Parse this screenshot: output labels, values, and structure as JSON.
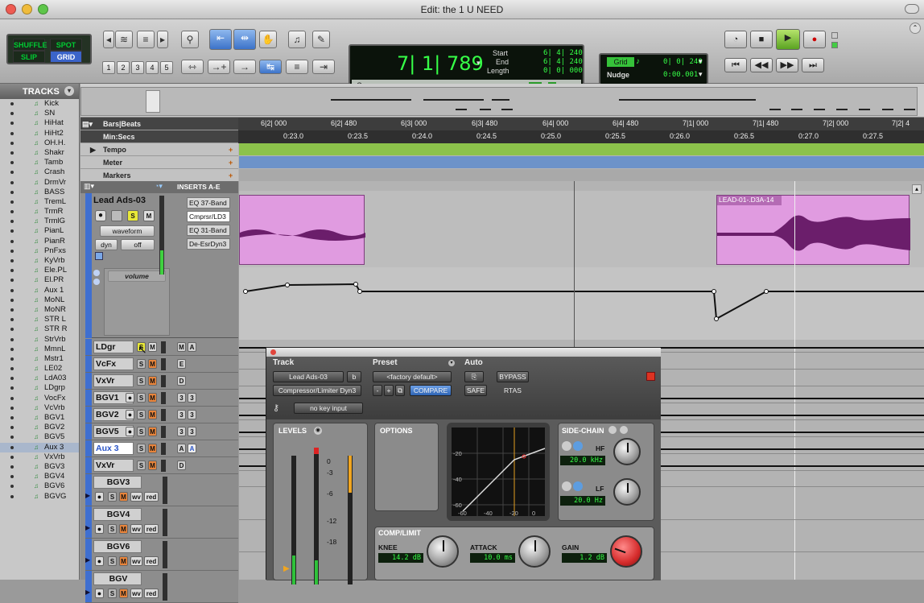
{
  "window": {
    "title": "Edit: the 1 U NEED"
  },
  "toolbar": {
    "modes": {
      "shuffle": "SHUFFLE",
      "spot": "SPOT",
      "slip": "SLIP",
      "grid": "GRID"
    },
    "zoom_presets": [
      "1",
      "2",
      "3",
      "4",
      "5"
    ],
    "counter": {
      "main": "7| 1| 789",
      "start_label": "Start",
      "end_label": "End",
      "length_label": "Length",
      "start": "6| 4| 240",
      "end": "6| 4| 240",
      "length": "0| 0| 000",
      "cursor_label": "Cursor"
    },
    "grid": {
      "label": "Grid",
      "value": "0| 0| 240",
      "nudge_label": "Nudge",
      "nudge_value": "0:00.001"
    }
  },
  "tracks_panel": {
    "title": "TRACKS",
    "items": [
      "Kick",
      "SN",
      "HiHat",
      "HiHt2",
      "OH.H.",
      "Shakr",
      "Tamb",
      "Crash",
      "DrmVr",
      "BASS",
      "TremL",
      "TrmR",
      "TrmlG",
      "PianL",
      "PianR",
      "PnFxs",
      "KyVrb",
      "Ele.PL",
      "El.PR",
      "Aux 1",
      "MoNL",
      "MoNR",
      "STR L",
      "STR R",
      "StrVrb",
      "MmnL",
      "Mstr1",
      "LE02",
      "LdA03",
      "LDgrp",
      "VocFx",
      "VcVrb",
      "BGV1",
      "BGV2",
      "BGV5",
      "Aux 3",
      "VxVrb",
      "BGV3",
      "BGV4",
      "BGV6",
      "BGVG"
    ],
    "selected_index": 35
  },
  "rulers": {
    "bars_label": "Bars|Beats",
    "minsecs_label": "Min:Secs",
    "tempo_label": "Tempo",
    "meter_label": "Meter",
    "markers_label": "Markers",
    "bars_ticks": [
      "6|2| 000",
      "6|2| 480",
      "6|3| 000",
      "6|3| 480",
      "6|4| 000",
      "6|4| 480",
      "7|1| 000",
      "7|1| 480",
      "7|2| 000",
      "7|2| 4"
    ],
    "secs_ticks": [
      "0:23.0",
      "0:23.5",
      "0:24.0",
      "0:24.5",
      "0:25.0",
      "0:25.5",
      "0:26.0",
      "0:26.5",
      "0:27.0",
      "0:27.5"
    ]
  },
  "mix": {
    "inserts_label": "INSERTS A-E",
    "main_track": {
      "name": "Lead Ads-03",
      "view": "waveform",
      "dyn": "dyn",
      "off": "off",
      "automation": "volume",
      "inserts": [
        "EQ 37-Band",
        "Cmprsr/LD3",
        "EQ 31-Band",
        "De-EsrDyn3"
      ]
    },
    "tracks": [
      {
        "name": "LDgr",
        "letters": [
          "M",
          "A"
        ]
      },
      {
        "name": "VcFx",
        "letters": [
          "E"
        ]
      },
      {
        "name": "VxVr",
        "letters": [
          "D"
        ]
      },
      {
        "name": "BGV1",
        "letters": [
          "3",
          "3"
        ]
      },
      {
        "name": "BGV2",
        "letters": [
          "3",
          "3"
        ]
      },
      {
        "name": "BGV5",
        "letters": [
          "3",
          "3"
        ]
      },
      {
        "name": "Aux 3",
        "letters": [
          "A",
          "A"
        ]
      },
      {
        "name": "VxVr",
        "letters": [
          "D"
        ]
      },
      {
        "name": "BGV3"
      },
      {
        "name": "BGV4"
      },
      {
        "name": "BGV6"
      },
      {
        "name": "BGV"
      }
    ],
    "btn_labels": {
      "s": "S",
      "m": "M",
      "wv": "wv",
      "red": "red"
    }
  },
  "edit": {
    "clip2_name": "LEAD-01-.D3A-14"
  },
  "plugin": {
    "track_label": "Track",
    "preset_label": "Preset",
    "auto_label": "Auto",
    "track_name": "Lead Ads-03",
    "track_b": "b",
    "preset_value": "<factory default>",
    "plugin_name": "Compressor/Limiter Dyn3",
    "compare": "COMPARE",
    "safe": "SAFE",
    "bypass": "BYPASS",
    "rtas": "RTAS",
    "key_input": "no key input",
    "levels_label": "LEVELS",
    "options_label": "OPTIONS",
    "sidechain_label": "SIDE-CHAIN",
    "complimit_label": "COMP/LIMIT",
    "meter_scale": [
      "0",
      "-3",
      "-6",
      "-12",
      "-18"
    ],
    "graph_y": [
      "-20",
      "-40",
      "-60"
    ],
    "graph_x": [
      "-60",
      "-40",
      "-20",
      "0"
    ],
    "hf_label": "HF",
    "hf_value": "20.0 kHz",
    "lf_label": "LF",
    "lf_value": "20.0 Hz",
    "knee_label": "KNEE",
    "knee_value": "14.2 dB",
    "attack_label": "ATTACK",
    "attack_value": "10.0 ms",
    "gain_label": "GAIN",
    "gain_value": "1.2 dB"
  }
}
